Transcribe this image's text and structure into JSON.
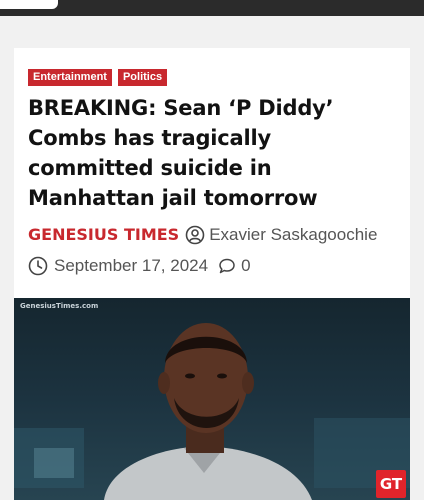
{
  "categories": [
    "Entertainment",
    "Politics"
  ],
  "article": {
    "headline": "BREAKING: Sean ‘P Diddy’ Combs has tragically committed suicide in Manhattan jail tomorrow",
    "site_name": "GENESIUS TIMES",
    "author": "Exavier Saskagoochie",
    "date": "September 17, 2024",
    "comment_count": "0"
  },
  "image": {
    "watermark": "GenesiusTimes.com",
    "logo_text": "GT"
  },
  "colors": {
    "accent": "#c8282e",
    "top_bar": "#2b2b2b"
  },
  "icons": [
    "author-icon",
    "clock-icon",
    "comment-icon"
  ]
}
